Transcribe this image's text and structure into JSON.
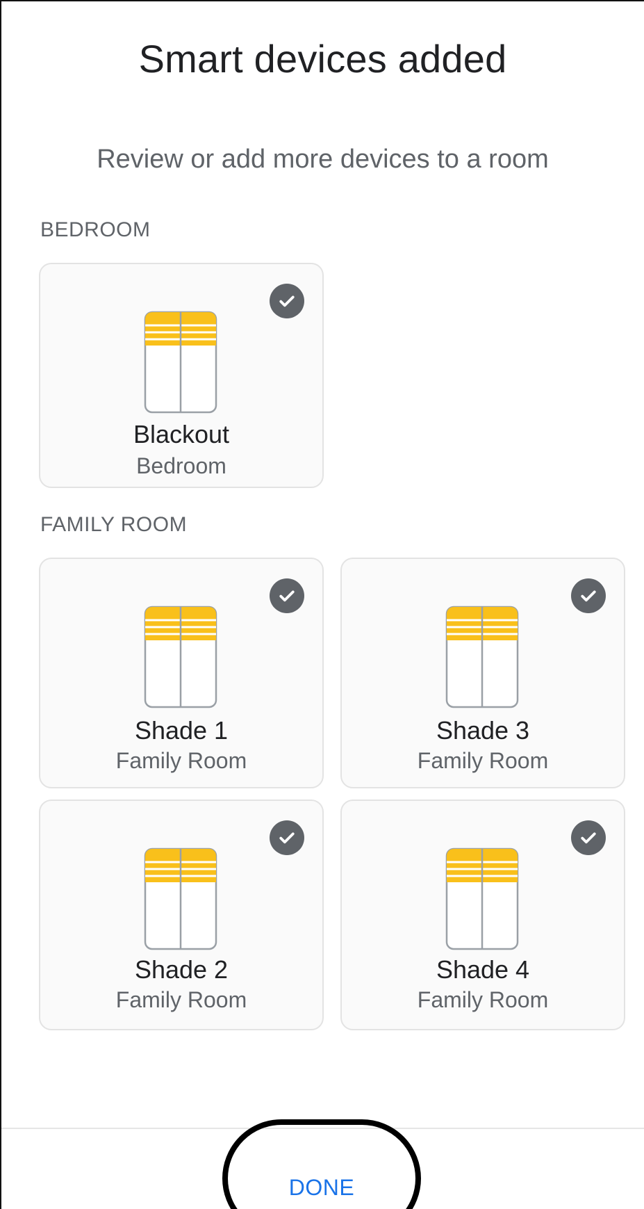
{
  "header": {
    "title": "Smart devices added",
    "subtitle": "Review or add more devices to a room"
  },
  "sections": [
    {
      "label": "BEDROOM",
      "devices": [
        {
          "name": "Blackout",
          "room": "Bedroom",
          "selected": true,
          "icon": "window-blinds-icon"
        }
      ]
    },
    {
      "label": "FAMILY ROOM",
      "devices": [
        {
          "name": "Shade 1",
          "room": "Family Room",
          "selected": true,
          "icon": "window-blinds-icon"
        },
        {
          "name": "Shade 3",
          "room": "Family Room",
          "selected": true,
          "icon": "window-blinds-icon"
        },
        {
          "name": "Shade 2",
          "room": "Family Room",
          "selected": true,
          "icon": "window-blinds-icon"
        },
        {
          "name": "Shade 4",
          "room": "Family Room",
          "selected": true,
          "icon": "window-blinds-icon"
        }
      ]
    }
  ],
  "footer": {
    "done_label": "DONE"
  },
  "colors": {
    "accent": "#1a73e8",
    "blind_yellow": "#f9c01b",
    "check_badge": "#5f6368"
  }
}
